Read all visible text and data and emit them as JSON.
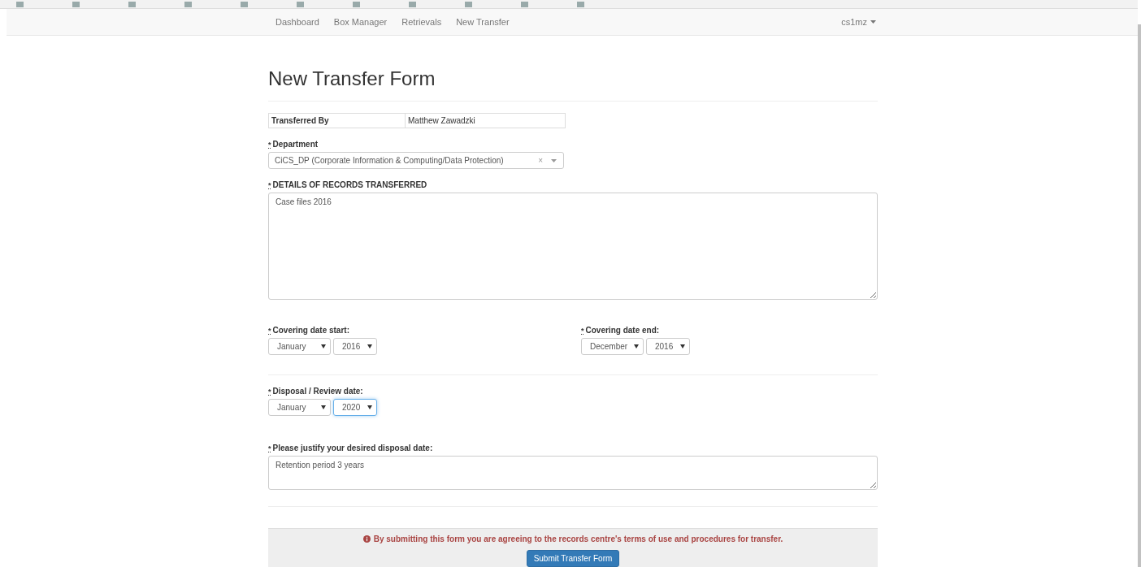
{
  "navbar": {
    "links": [
      {
        "label": "Dashboard",
        "selected": false
      },
      {
        "label": "Box Manager",
        "selected": false
      },
      {
        "label": "Retrievals",
        "selected": false
      },
      {
        "label": "New Transfer",
        "selected": false
      }
    ],
    "user": "cs1mz"
  },
  "form": {
    "title": "New Transfer Form",
    "transferred_by": {
      "label": "Transferred By",
      "value": "Matthew Zawadzki"
    },
    "department": {
      "marker": "*",
      "label": "Department",
      "value": "CiCS_DP (Corporate Information & Computing/Data Protection)",
      "clear": "×"
    },
    "details": {
      "marker": "*",
      "label": "DETAILS OF RECORDS TRANSFERRED",
      "value": "Case files 2016"
    },
    "covering_start": {
      "marker": "*",
      "label": "Covering date start:",
      "month": {
        "value": "January",
        "focused": false
      },
      "year": {
        "value": "2016",
        "focused": false
      }
    },
    "covering_end": {
      "marker": "*",
      "label": "Covering date end:",
      "month": {
        "value": "December",
        "focused": false
      },
      "year": {
        "value": "2016",
        "focused": false
      }
    },
    "disposal": {
      "marker": "*",
      "label": "Disposal / Review date:",
      "month": {
        "value": "January",
        "focused": false
      },
      "year": {
        "value": "2020",
        "focused": true
      }
    },
    "justify": {
      "marker": "*",
      "label": "Please justify your desired disposal date:",
      "value": "Retention period 3 years"
    }
  },
  "footer": {
    "notice": "By submitting this form you are agreeing to the records centre's terms of use and procedures for transfer.",
    "button": "Submit Transfer Form"
  }
}
